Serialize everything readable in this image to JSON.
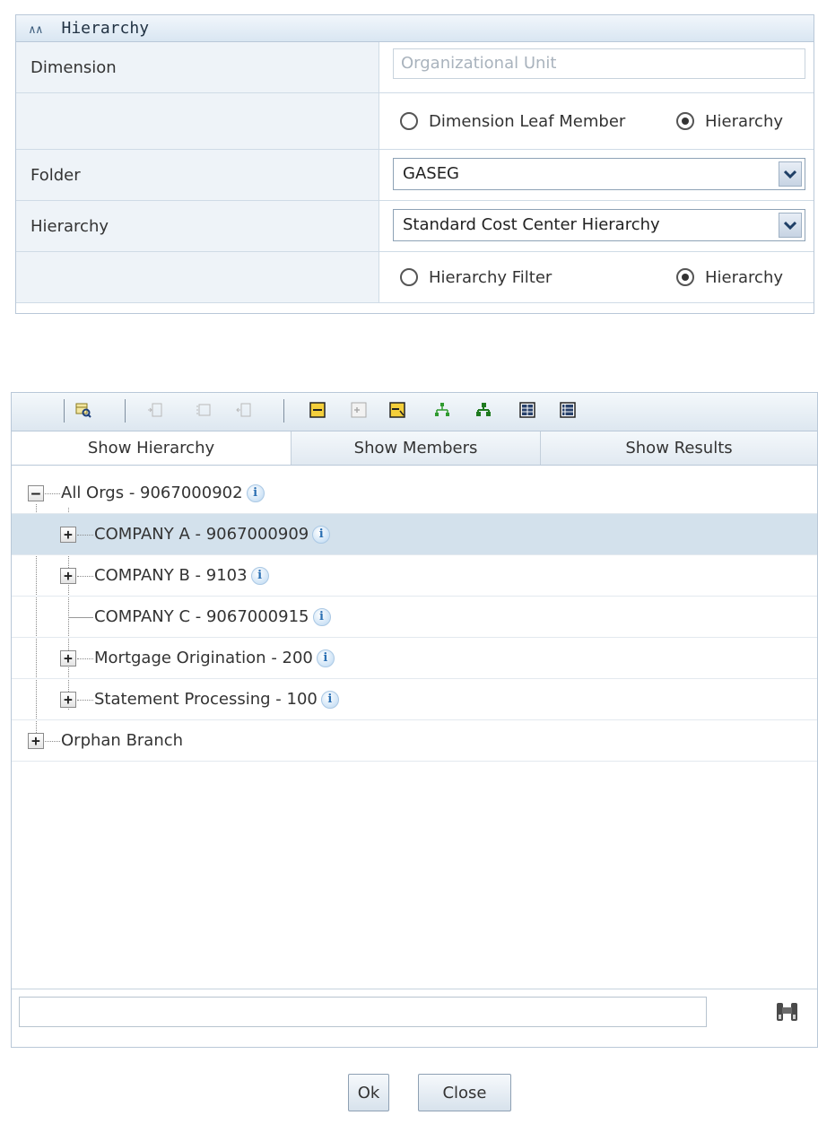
{
  "hierarchy_panel": {
    "title": "Hierarchy",
    "dimension": {
      "label": "Dimension",
      "value": "Organizational Unit"
    },
    "type_options": [
      {
        "label": "Dimension Leaf Member",
        "checked": false
      },
      {
        "label": "Hierarchy",
        "checked": true
      }
    ],
    "folder": {
      "label": "Folder",
      "selected": "GASEG"
    },
    "hierarchy": {
      "label": "Hierarchy",
      "selected": "Standard Cost Center Hierarchy"
    },
    "filter_options": [
      {
        "label": "Hierarchy Filter",
        "checked": false
      },
      {
        "label": "Hierarchy",
        "checked": true
      }
    ]
  },
  "tree_panel": {
    "toolbar_icons": [
      "search-hierarchy-icon",
      "indent-icon",
      "align-icon",
      "outdent-icon",
      "collapse-all-icon",
      "expand-all-icon",
      "focus-node-icon",
      "show-tree-icon",
      "show-tree-alt-icon",
      "grid-view-icon",
      "list-view-icon"
    ],
    "tabs": [
      "Show Hierarchy",
      "Show Members",
      "Show Results"
    ],
    "active_tab": "Show Hierarchy",
    "nodes": [
      {
        "label": "All Orgs - 9067000902",
        "level": 0,
        "expander": "minus",
        "info": true,
        "selected": false
      },
      {
        "label": "COMPANY A - 9067000909",
        "level": 1,
        "expander": "plus",
        "info": true,
        "selected": true
      },
      {
        "label": "COMPANY B - 9103",
        "level": 1,
        "expander": "plus",
        "info": true,
        "selected": false
      },
      {
        "label": "COMPANY C - 9067000915",
        "level": 1,
        "expander": "none",
        "info": true,
        "selected": false
      },
      {
        "label": "Mortgage Origination - 200",
        "level": 1,
        "expander": "plus",
        "info": true,
        "selected": false
      },
      {
        "label": "Statement Processing - 100",
        "level": 1,
        "expander": "plus",
        "info": true,
        "selected": false
      },
      {
        "label": "Orphan Branch",
        "level": 0,
        "expander": "plus",
        "info": false,
        "selected": false
      }
    ],
    "info_glyph": "i",
    "search_value": ""
  },
  "buttons": {
    "ok": "Ok",
    "close": "Close"
  },
  "colors": {
    "header_bg": "#dbe7f3",
    "selected_row": "#d3e1ec",
    "border": "#b9c8d8"
  }
}
